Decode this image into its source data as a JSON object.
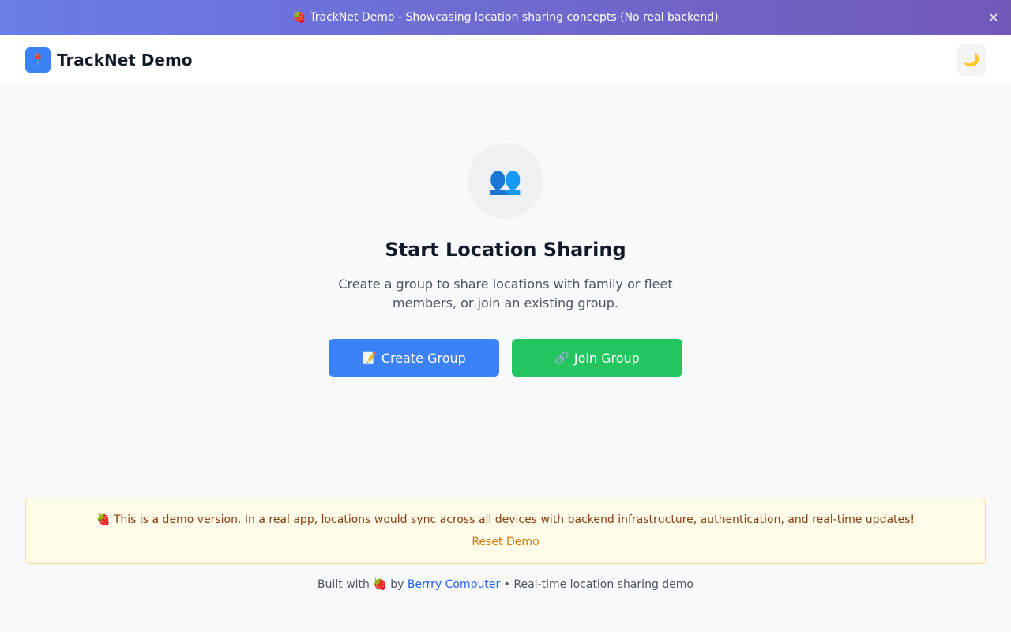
{
  "banner": {
    "text": "🍓 TrackNet Demo - Showcasing location sharing concepts (No real backend)",
    "close_label": "×"
  },
  "header": {
    "logo_icon": "📍",
    "title": "TrackNet Demo",
    "theme_icon": "🌙"
  },
  "hero": {
    "icon": "👥",
    "title": "Start Location Sharing",
    "description": "Create a group to share locations with family or fleet members, or join an existing group."
  },
  "actions": {
    "create": {
      "icon": "📝",
      "label": "Create Group"
    },
    "join": {
      "icon": "🔗",
      "label": "Join Group"
    }
  },
  "notice": {
    "text": "🍓 This is a demo version. In a real app, locations would sync across all devices with backend infrastructure, authentication, and real-time updates!",
    "reset_label": "Reset Demo"
  },
  "footer": {
    "prefix": "Built with 🍓 by",
    "link_text": "Berrry Computer",
    "suffix": "• Real-time location sharing demo"
  },
  "colors": {
    "primary": "#3b82f6",
    "success": "#22c55e",
    "banner_start": "#6a7de8",
    "banner_end": "#7358b8",
    "notice_bg": "#fefbe8",
    "link": "#2563eb"
  }
}
